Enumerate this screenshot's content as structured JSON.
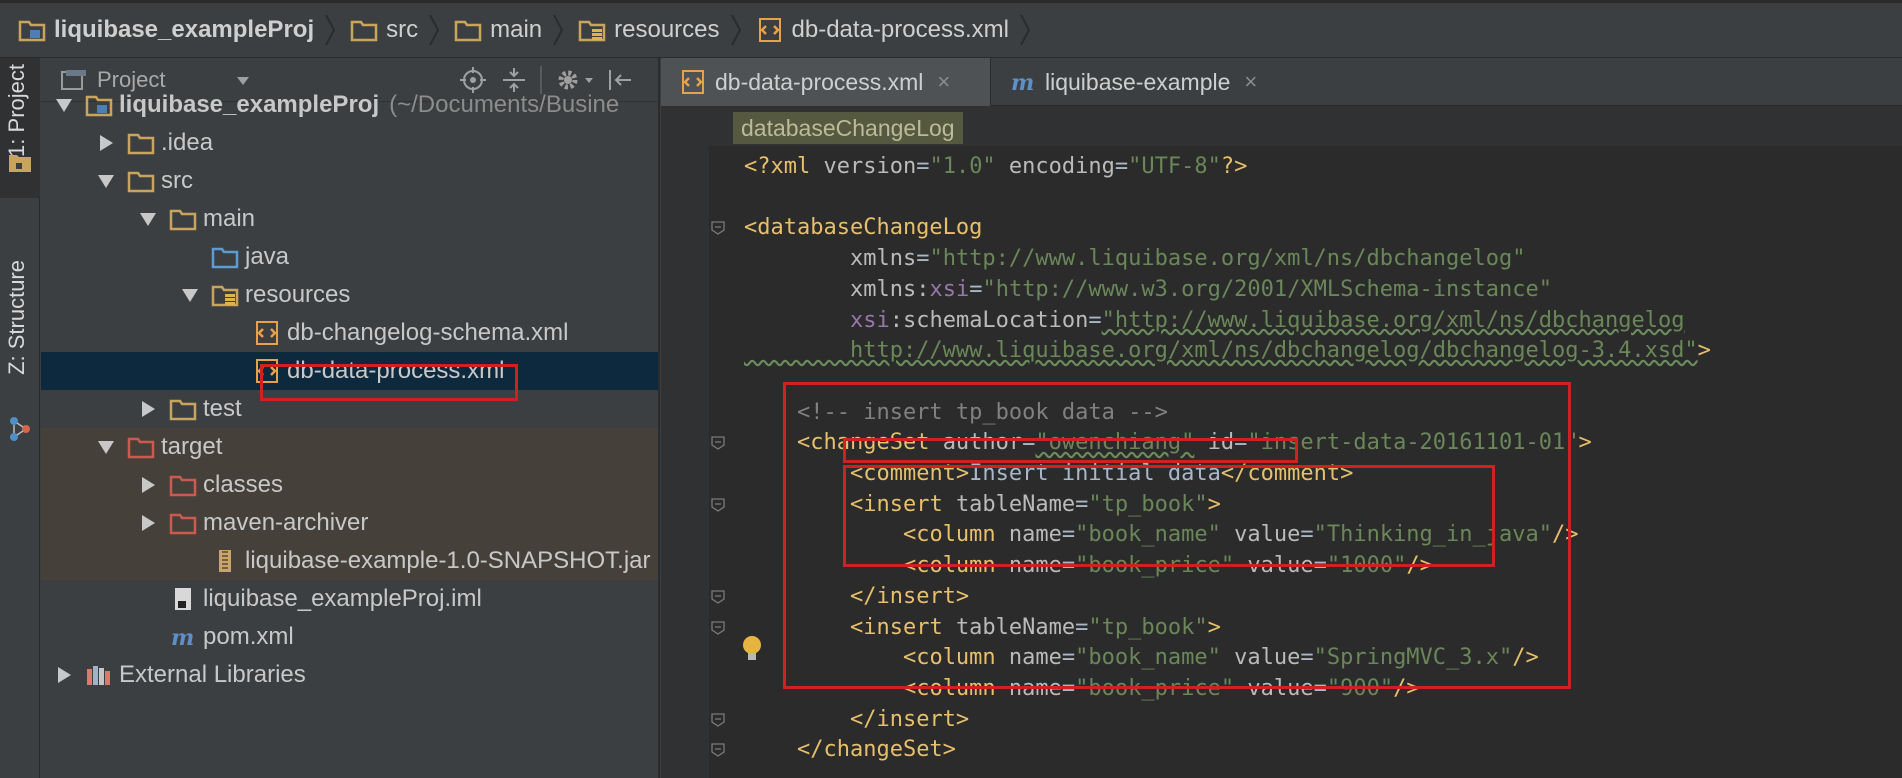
{
  "breadcrumb": [
    {
      "label": "liquibase_exampleProj",
      "icon": "project-folder-icon",
      "bold": true
    },
    {
      "label": "src",
      "icon": "folder-icon",
      "bold": false
    },
    {
      "label": "main",
      "icon": "folder-icon",
      "bold": false
    },
    {
      "label": "resources",
      "icon": "resources-folder-icon",
      "bold": false
    },
    {
      "label": "db-data-process.xml",
      "icon": "xml-file-icon",
      "bold": false
    }
  ],
  "tool_stripe": {
    "project_label": "1: Project",
    "structure_label": "Z: Structure"
  },
  "project_panel": {
    "view_selector": "Project",
    "tree": [
      {
        "label": "liquibase_exampleProj",
        "hint": "(~/Documents/Busine",
        "icon": "project-folder-icon",
        "expanded": true,
        "bold": true
      },
      {
        "label": ".idea",
        "icon": "folder-icon",
        "expanded": false
      },
      {
        "label": "src",
        "icon": "folder-icon",
        "expanded": true
      },
      {
        "label": "main",
        "icon": "folder-icon",
        "expanded": true
      },
      {
        "label": "java",
        "icon": "source-folder-icon"
      },
      {
        "label": "resources",
        "icon": "resources-folder-icon",
        "expanded": true
      },
      {
        "label": "db-changelog-schema.xml",
        "icon": "xml-file-icon"
      },
      {
        "label": "db-data-process.xml",
        "icon": "xml-file-icon",
        "selected": true
      },
      {
        "label": "test",
        "icon": "folder-icon",
        "expanded": false
      },
      {
        "label": "target",
        "icon": "excluded-folder-icon",
        "expanded": true
      },
      {
        "label": "classes",
        "icon": "excluded-folder-icon",
        "expanded": false
      },
      {
        "label": "maven-archiver",
        "icon": "excluded-folder-icon",
        "expanded": false
      },
      {
        "label": "liquibase-example-1.0-SNAPSHOT.jar",
        "icon": "jar-file-icon"
      },
      {
        "label": "liquibase_exampleProj.iml",
        "icon": "iml-file-icon"
      },
      {
        "label": "pom.xml",
        "icon": "maven-icon"
      },
      {
        "label": "External Libraries",
        "icon": "libraries-icon",
        "expanded": false
      }
    ]
  },
  "editor": {
    "tabs": [
      {
        "label": "db-data-process.xml",
        "icon": "xml-file-icon",
        "active": true
      },
      {
        "label": "liquibase-example",
        "icon": "maven-icon",
        "active": false
      }
    ],
    "breadcrumb_tag": "databaseChangeLog",
    "code_lines": [
      [
        [
          "pi",
          "<?xml "
        ],
        [
          "attr",
          "version"
        ],
        [
          "txt",
          "="
        ],
        [
          "val",
          "\"1.0\""
        ],
        [
          "attr",
          " encoding"
        ],
        [
          "txt",
          "="
        ],
        [
          "val",
          "\"UTF-8\""
        ],
        [
          "pi",
          "?>"
        ]
      ],
      [],
      [
        [
          "tag",
          "<databaseChangeLog"
        ]
      ],
      [
        [
          "txt",
          "        "
        ],
        [
          "attr",
          "xmlns"
        ],
        [
          "txt",
          "="
        ],
        [
          "val",
          "\"http://www.liquibase.org/xml/ns/dbchangelog\""
        ]
      ],
      [
        [
          "txt",
          "        "
        ],
        [
          "attr",
          "xmlns:"
        ],
        [
          "ns",
          "xsi"
        ],
        [
          "txt",
          "="
        ],
        [
          "val",
          "\"http://www.w3.org/2001/XMLSchema-instance\""
        ]
      ],
      [
        [
          "txt",
          "        "
        ],
        [
          "ns",
          "xsi"
        ],
        [
          "attr",
          ":schemaLocation"
        ],
        [
          "txt",
          "="
        ],
        [
          "val",
          "\"http://www.liquibase.org/xml/ns/dbchangelog"
        ]
      ],
      [
        [
          "val",
          "        http://www.liquibase.org/xml/ns/dbchangelog/dbchangelog-3.4.xsd\""
        ],
        [
          "tag",
          ">"
        ]
      ],
      [],
      [
        [
          "cm",
          "    <!-- insert tp_book data -->"
        ]
      ],
      [
        [
          "txt",
          "    "
        ],
        [
          "tag",
          "<changeSet "
        ],
        [
          "attr",
          "author"
        ],
        [
          "txt",
          "="
        ],
        [
          "val",
          "\"owenchiang\""
        ],
        [
          "attr",
          " id"
        ],
        [
          "txt",
          "="
        ],
        [
          "val",
          "\"insert-data-20161101-01\""
        ],
        [
          "tag",
          ">"
        ]
      ],
      [
        [
          "txt",
          "        "
        ],
        [
          "tag",
          "<comment>"
        ],
        [
          "txt",
          "Insert initial data"
        ],
        [
          "tag",
          "</comment>"
        ]
      ],
      [
        [
          "txt",
          "        "
        ],
        [
          "tag",
          "<insert "
        ],
        [
          "attr",
          "tableName"
        ],
        [
          "txt",
          "="
        ],
        [
          "val",
          "\"tp_book\""
        ],
        [
          "tag",
          ">"
        ]
      ],
      [
        [
          "txt",
          "            "
        ],
        [
          "tag",
          "<column "
        ],
        [
          "attr",
          "name"
        ],
        [
          "txt",
          "="
        ],
        [
          "val",
          "\"book_name\""
        ],
        [
          "attr",
          " value"
        ],
        [
          "txt",
          "="
        ],
        [
          "val",
          "\"Thinking_in_java\""
        ],
        [
          "tag",
          "/>"
        ]
      ],
      [
        [
          "txt",
          "            "
        ],
        [
          "tag",
          "<column "
        ],
        [
          "attr",
          "name"
        ],
        [
          "txt",
          "="
        ],
        [
          "val",
          "\"book_price\""
        ],
        [
          "attr",
          " value"
        ],
        [
          "txt",
          "="
        ],
        [
          "val",
          "\"1000\""
        ],
        [
          "tag",
          "/>"
        ]
      ],
      [
        [
          "txt",
          "        "
        ],
        [
          "tag",
          "</insert>"
        ]
      ],
      [
        [
          "txt",
          "        "
        ],
        [
          "tag",
          "<insert "
        ],
        [
          "attr",
          "tableName"
        ],
        [
          "txt",
          "="
        ],
        [
          "val",
          "\"tp_book\""
        ],
        [
          "tag",
          ">"
        ]
      ],
      [
        [
          "txt",
          "            "
        ],
        [
          "tag",
          "<column "
        ],
        [
          "attr",
          "name"
        ],
        [
          "txt",
          "="
        ],
        [
          "val",
          "\"book_name\""
        ],
        [
          "attr",
          " value"
        ],
        [
          "txt",
          "="
        ],
        [
          "val",
          "\"SpringMVC_3.x\""
        ],
        [
          "tag",
          "/>"
        ]
      ],
      [
        [
          "txt",
          "            "
        ],
        [
          "tag",
          "<column "
        ],
        [
          "attr",
          "name"
        ],
        [
          "txt",
          "="
        ],
        [
          "val",
          "\"book_price\""
        ],
        [
          "attr",
          " value"
        ],
        [
          "txt",
          "="
        ],
        [
          "val",
          "\"900\""
        ],
        [
          "tag",
          "/>"
        ]
      ],
      [
        [
          "txt",
          "        "
        ],
        [
          "tag",
          "</insert>"
        ]
      ],
      [
        [
          "txt",
          "    "
        ],
        [
          "tag",
          "</changeSet>"
        ]
      ]
    ]
  },
  "colors": {
    "highlight_box": "#d0201f",
    "selection_bg": "#0d293e",
    "excluded_bg": "#45413a",
    "tag": "#e8bf6a",
    "string": "#6a8759",
    "namespace": "#9876aa",
    "comment": "#808080"
  }
}
